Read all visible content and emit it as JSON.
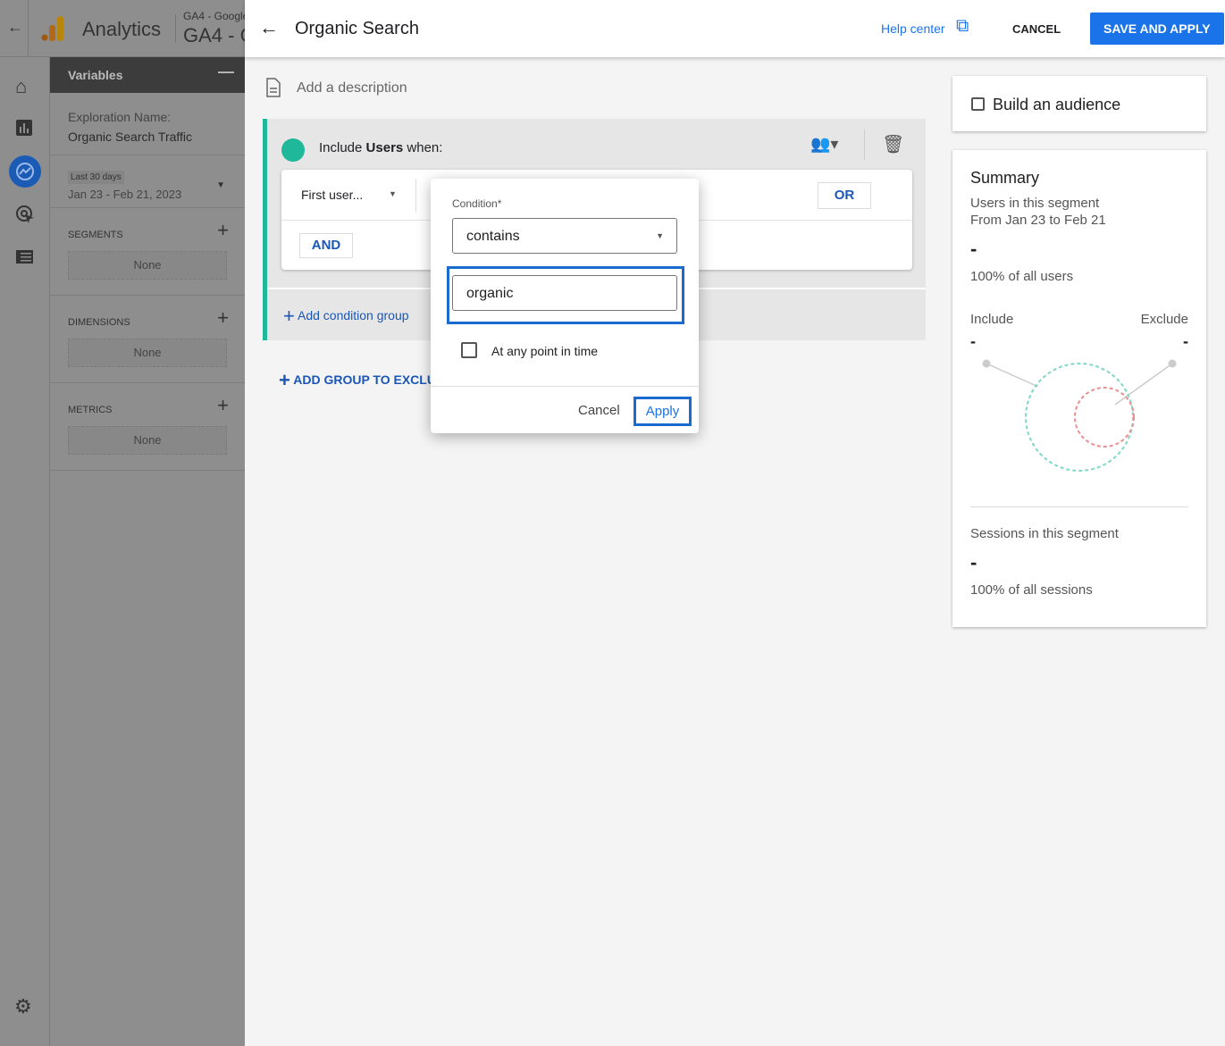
{
  "app": {
    "name": "Analytics",
    "property_small": "GA4 - Google",
    "property": "GA4 - G"
  },
  "nav": {
    "items": [
      "home",
      "reports",
      "explore",
      "advertising",
      "configure"
    ],
    "settings": "settings"
  },
  "variables": {
    "title": "Variables",
    "exploration_label": "Exploration Name:",
    "exploration_name": "Organic Search Traffic",
    "date_badge": "Last 30 days",
    "date_range": "Jan 23 - Feb 21, 2023",
    "segments": "SEGMENTS",
    "dimensions": "DIMENSIONS",
    "metrics": "METRICS",
    "none": "None"
  },
  "header": {
    "title": "Organic Search",
    "help": "Help center",
    "cancel": "CANCEL",
    "save": "SAVE AND APPLY"
  },
  "editor": {
    "description_placeholder": "Add a description",
    "include_prefix": "Include ",
    "include_bold": "Users",
    "include_suffix": " when:",
    "dimension": "First user...",
    "or": "OR",
    "and": "AND",
    "add_condition_group": "Add condition group",
    "add_group_exclude": "ADD GROUP TO EXCLU"
  },
  "popup": {
    "condition_label": "Condition*",
    "condition_value": "contains",
    "input_value": "organic",
    "checkbox_label": "At any point in time",
    "cancel": "Cancel",
    "apply": "Apply"
  },
  "audience": {
    "label": "Build an audience"
  },
  "summary": {
    "title": "Summary",
    "users_label": "Users in this segment",
    "range": "From Jan 23 to Feb 21",
    "users_value": "-",
    "users_pct": "100% of all users",
    "include": "Include",
    "exclude": "Exclude",
    "include_value": "-",
    "exclude_value": "-",
    "sessions_label": "Sessions in this segment",
    "sessions_value": "-",
    "sessions_pct": "100% of all sessions"
  },
  "colors": {
    "accent": "#1a73e8",
    "segment": "#1fb89a",
    "exclude": "#e57373"
  }
}
